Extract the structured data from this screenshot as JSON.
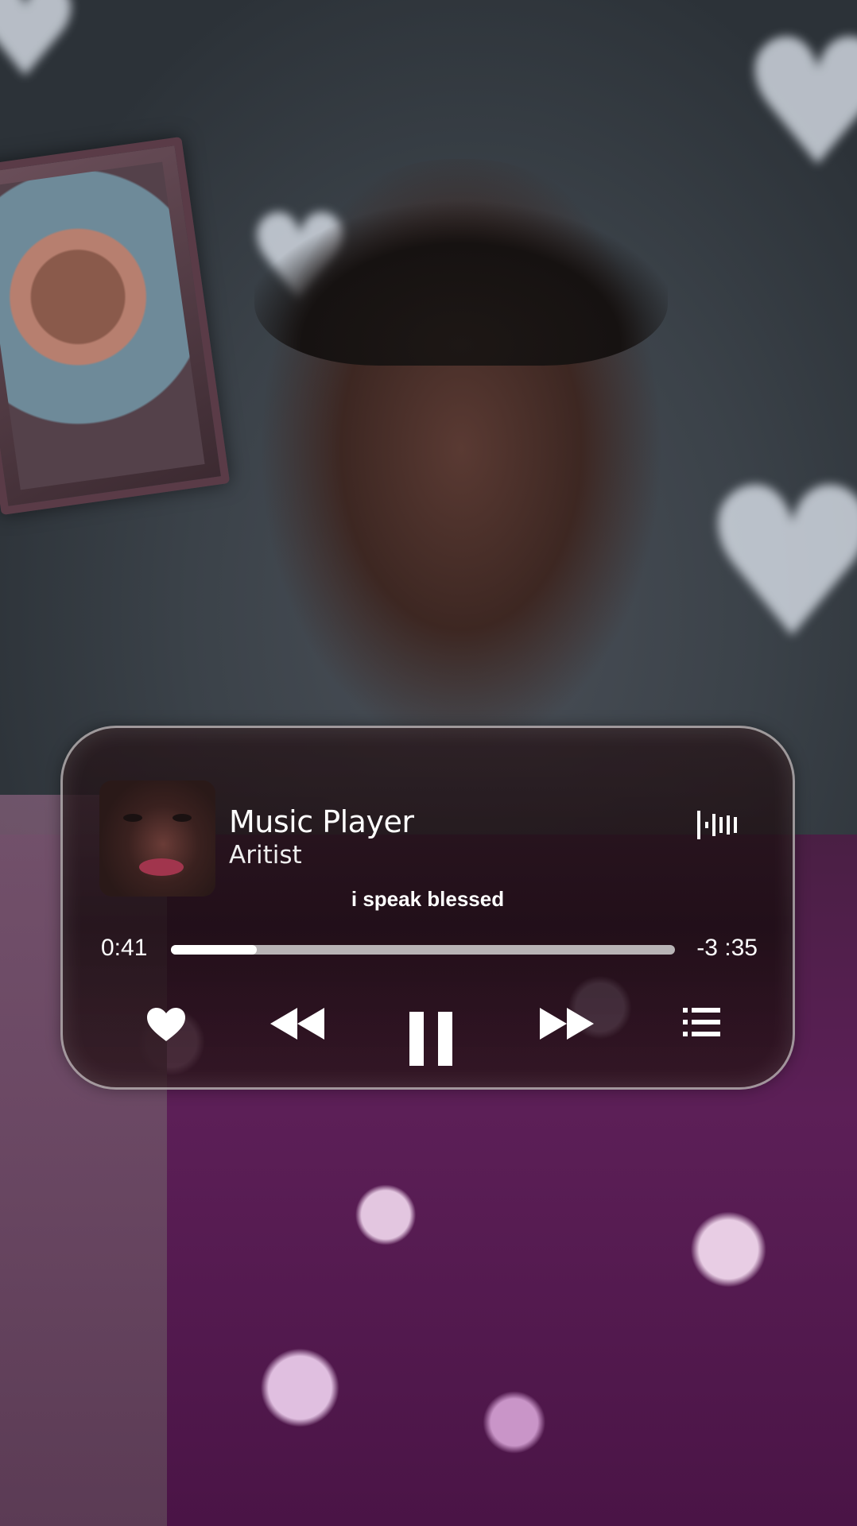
{
  "player": {
    "title": "Music Player",
    "artist": "Aritist",
    "lyric": "i speak blessed",
    "time_elapsed": "0:41",
    "time_remaining": "-3 :35",
    "progress_fraction": 0.17,
    "icons": {
      "waveform": "waveform-icon",
      "like": "heart-icon",
      "rewind": "rewind-icon",
      "pause": "pause-icon",
      "forward": "fast-forward-icon",
      "queue": "list-icon"
    }
  }
}
